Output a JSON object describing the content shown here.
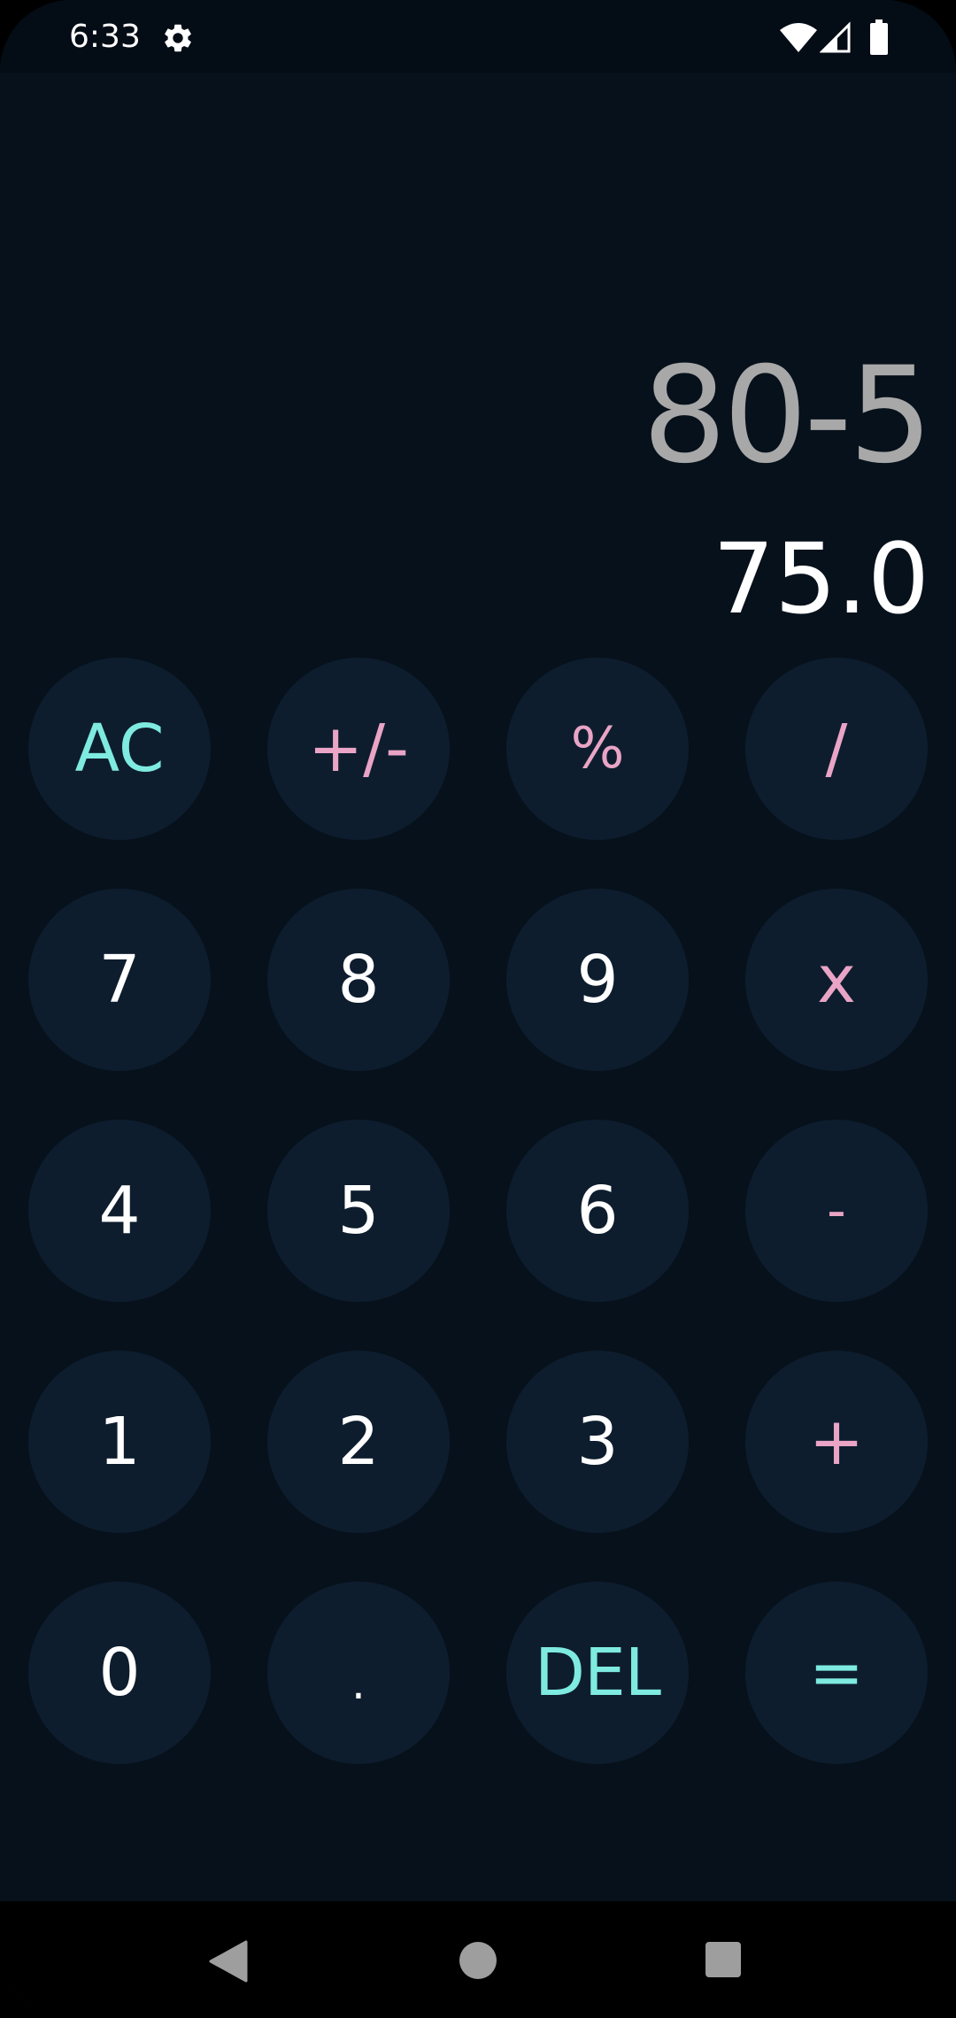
{
  "status_bar": {
    "time": "6:33",
    "icons": [
      "gear-icon",
      "wifi-icon",
      "cell-signal-icon",
      "battery-icon"
    ]
  },
  "display": {
    "expression": "80-5",
    "result": "75.0"
  },
  "keypad": {
    "rows": [
      [
        {
          "label": "AC",
          "color": "#7eeae0"
        },
        {
          "label": "+/-",
          "color": "#e9a4c6"
        },
        {
          "label": "%",
          "color": "#e9a4c6"
        },
        {
          "label": "/",
          "color": "#e9a4c6"
        }
      ],
      [
        {
          "label": "7",
          "color": "#ffffff"
        },
        {
          "label": "8",
          "color": "#ffffff"
        },
        {
          "label": "9",
          "color": "#ffffff"
        },
        {
          "label": "x",
          "color": "#e9a4c6"
        }
      ],
      [
        {
          "label": "4",
          "color": "#ffffff"
        },
        {
          "label": "5",
          "color": "#ffffff"
        },
        {
          "label": "6",
          "color": "#ffffff"
        },
        {
          "label": "-",
          "color": "#e9a4c6"
        }
      ],
      [
        {
          "label": "1",
          "color": "#ffffff"
        },
        {
          "label": "2",
          "color": "#ffffff"
        },
        {
          "label": "3",
          "color": "#ffffff"
        },
        {
          "label": "+",
          "color": "#e9a4c6"
        }
      ],
      [
        {
          "label": "0",
          "color": "#ffffff"
        },
        {
          "label": ".",
          "color": "#ffffff"
        },
        {
          "label": "DEL",
          "color": "#7eeae0"
        },
        {
          "label": "=",
          "color": "#7eeae0"
        }
      ]
    ]
  },
  "nav_bar": {
    "icons": [
      "back-icon",
      "home-icon",
      "recents-icon"
    ]
  },
  "colors": {
    "background": "#07111b",
    "key_background": "#0d1d2e",
    "accent_teal": "#7eeae0",
    "accent_pink": "#e9a4c6",
    "expression_text": "#a8a8a8"
  }
}
